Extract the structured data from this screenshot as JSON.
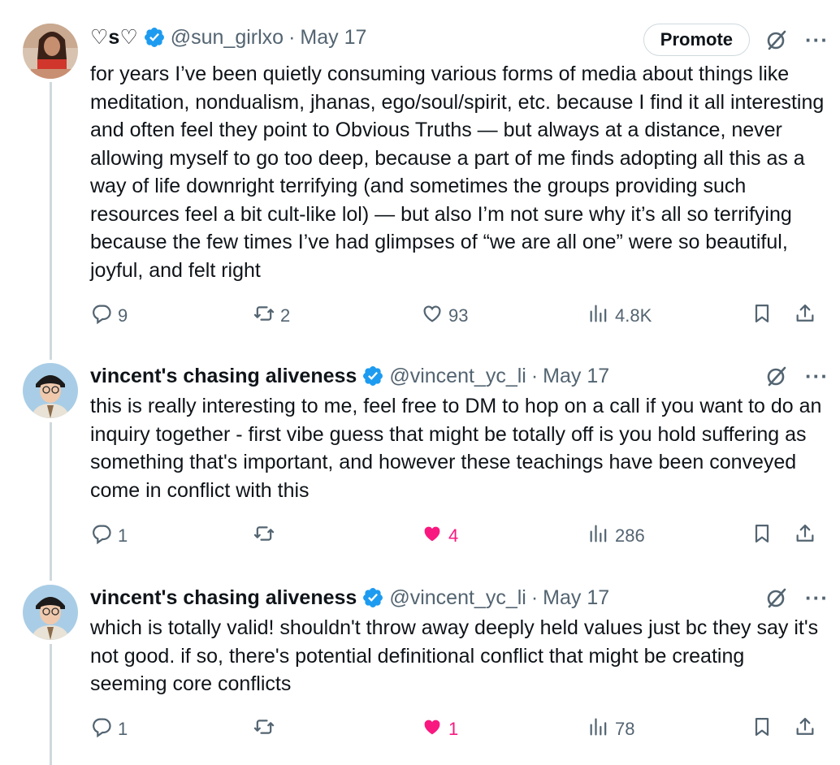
{
  "tweets": [
    {
      "name": "♡s♡",
      "handle": "@sun_girlxo",
      "dot": "·",
      "date": "May 17",
      "promote_label": "Promote",
      "text": "for years I’ve been quietly consuming various forms of media about things like meditation, nondualism, jhanas, ego/soul/spirit, etc. because I find it all interesting and often feel they point to Obvious Truths — but always at a distance, never allowing myself to go too deep, because a part of me finds adopting all this as a way of life downright terrifying (and sometimes the groups providing such  resources feel a bit cult-like lol) — but also I’m not sure why it’s all so terrifying because the few times I’ve had glimpses of “we are all one” were so beautiful, joyful, and felt right",
      "replies": "9",
      "retweets": "2",
      "likes": "93",
      "views": "4.8K"
    },
    {
      "name": "vincent's chasing aliveness",
      "handle": "@vincent_yc_li",
      "dot": "·",
      "date": "May 17",
      "text": "this is really interesting to me, feel free to DM to hop on a call if you want to do an inquiry together - first vibe guess that might be totally off is you hold suffering as something that's important, and however these teachings have been conveyed come in conflict with this",
      "replies": "1",
      "retweets": "",
      "likes": "4",
      "views": "286"
    },
    {
      "name": "vincent's chasing aliveness",
      "handle": "@vincent_yc_li",
      "dot": "·",
      "date": "May 17",
      "text": "which is totally valid! shouldn't throw away deeply held values just bc they say it's not good. if so, there's potential definitional conflict that might be creating seeming core conflicts",
      "replies": "1",
      "retweets": "",
      "likes": "1",
      "views": "78"
    }
  ],
  "colors": {
    "accent": "#1d9bf0",
    "like": "#f91880",
    "muted": "#536471",
    "text": "#0f1419"
  },
  "icons": [
    "verified-badge-icon",
    "grok-icon",
    "more-icon",
    "reply-icon",
    "retweet-icon",
    "like-icon",
    "views-icon",
    "bookmark-icon",
    "share-icon"
  ]
}
